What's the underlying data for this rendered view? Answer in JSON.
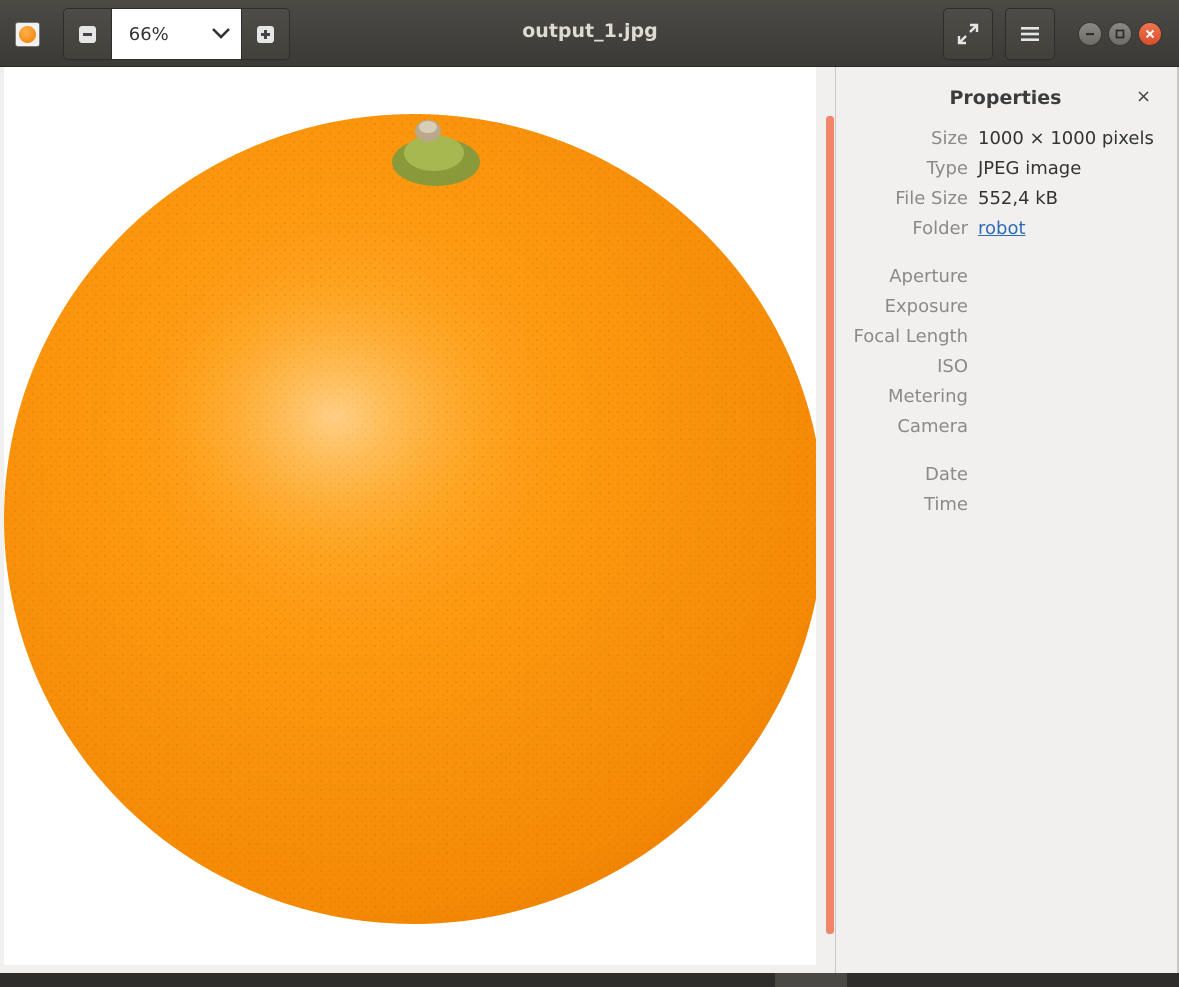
{
  "header": {
    "app_icon": "image-viewer-app-icon",
    "zoom": {
      "value": "66%",
      "zoom_out_icon": "minus-square-icon",
      "zoom_in_icon": "plus-square-icon",
      "dropdown_icon": "chevron-down-icon"
    },
    "title": "output_1.jpg",
    "fullscreen_icon": "expand-icon",
    "menu_icon": "hamburger-icon",
    "window_controls": [
      "minimize-icon",
      "maximize-icon",
      "close-icon"
    ]
  },
  "properties": {
    "title": "Properties",
    "close_label": "×",
    "general": [
      {
        "label": "Size",
        "value": "1000 × 1000 pixels"
      },
      {
        "label": "Type",
        "value": "JPEG image"
      },
      {
        "label": "File Size",
        "value": "552,4 kB"
      },
      {
        "label": "Folder",
        "value": "robot"
      }
    ],
    "exif": [
      {
        "label": "Aperture"
      },
      {
        "label": "Exposure"
      },
      {
        "label": "Focal Length"
      },
      {
        "label": "ISO"
      },
      {
        "label": "Metering"
      },
      {
        "label": "Camera"
      }
    ],
    "datetime": [
      {
        "label": "Date"
      },
      {
        "label": "Time"
      }
    ]
  },
  "colors": {
    "scrollbar": "#f2856a",
    "link": "#2e6db5",
    "close_button": "#e0593a"
  }
}
